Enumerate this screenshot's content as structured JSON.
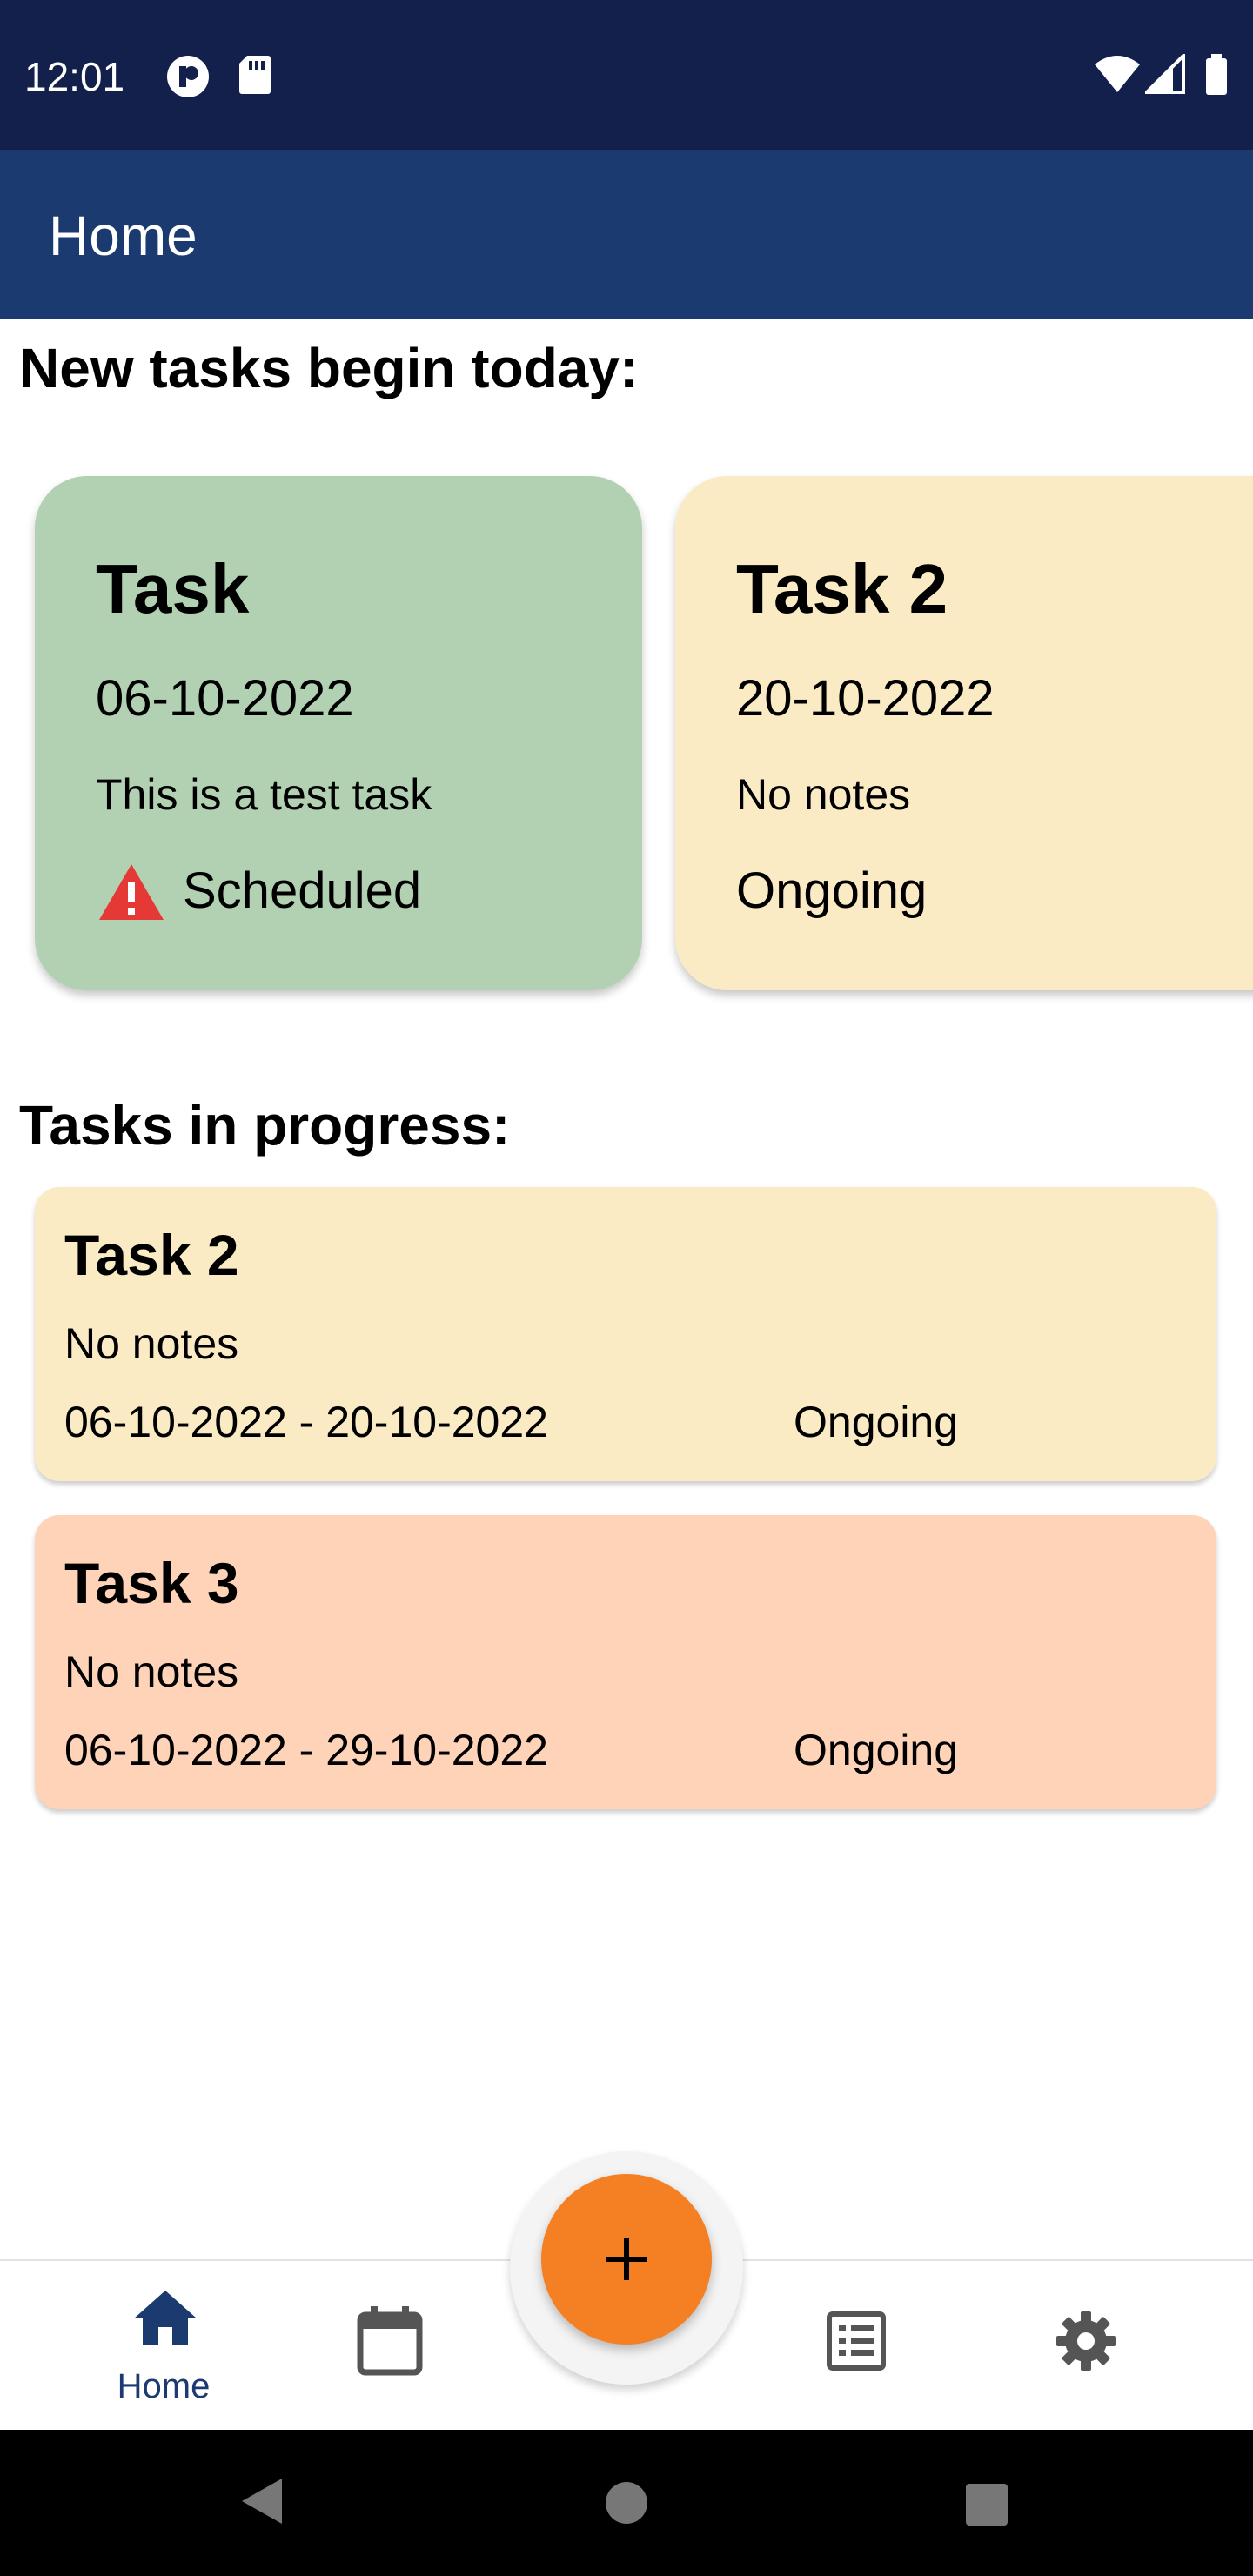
{
  "status_bar": {
    "time": "12:01"
  },
  "app_bar": {
    "title": "Home"
  },
  "sections": {
    "new_tasks_title": "New tasks begin today:",
    "in_progress_title": "Tasks in progress:"
  },
  "new_tasks": [
    {
      "title": "Task",
      "date": "06-10-2022",
      "notes": "This is a test task",
      "status": "Scheduled",
      "status_icon": "warning-icon",
      "color": "#b2d1b3"
    },
    {
      "title": "Task 2",
      "date": "20-10-2022",
      "notes": "No notes",
      "status": "Ongoing",
      "color": "#fbebc4"
    }
  ],
  "in_progress": [
    {
      "title": "Task 2",
      "notes": "No notes",
      "range": "06-10-2022 - 20-10-2022",
      "status": "Ongoing",
      "color": "#fbebc4"
    },
    {
      "title": "Task 3",
      "notes": "No notes",
      "range": "06-10-2022 - 29-10-2022",
      "status": "Ongoing",
      "color": "#fed3b8"
    }
  ],
  "bottom_nav": {
    "home_label": "Home",
    "items": [
      "home-icon",
      "calendar-icon",
      "add-icon",
      "list-icon",
      "settings-icon"
    ],
    "active_color": "#1b3a70",
    "inactive_color": "#555555",
    "fab_color": "#f58024"
  },
  "colors": {
    "status_bar": "#13204c",
    "app_bar": "#1b3a70",
    "warning": "#e53935"
  }
}
